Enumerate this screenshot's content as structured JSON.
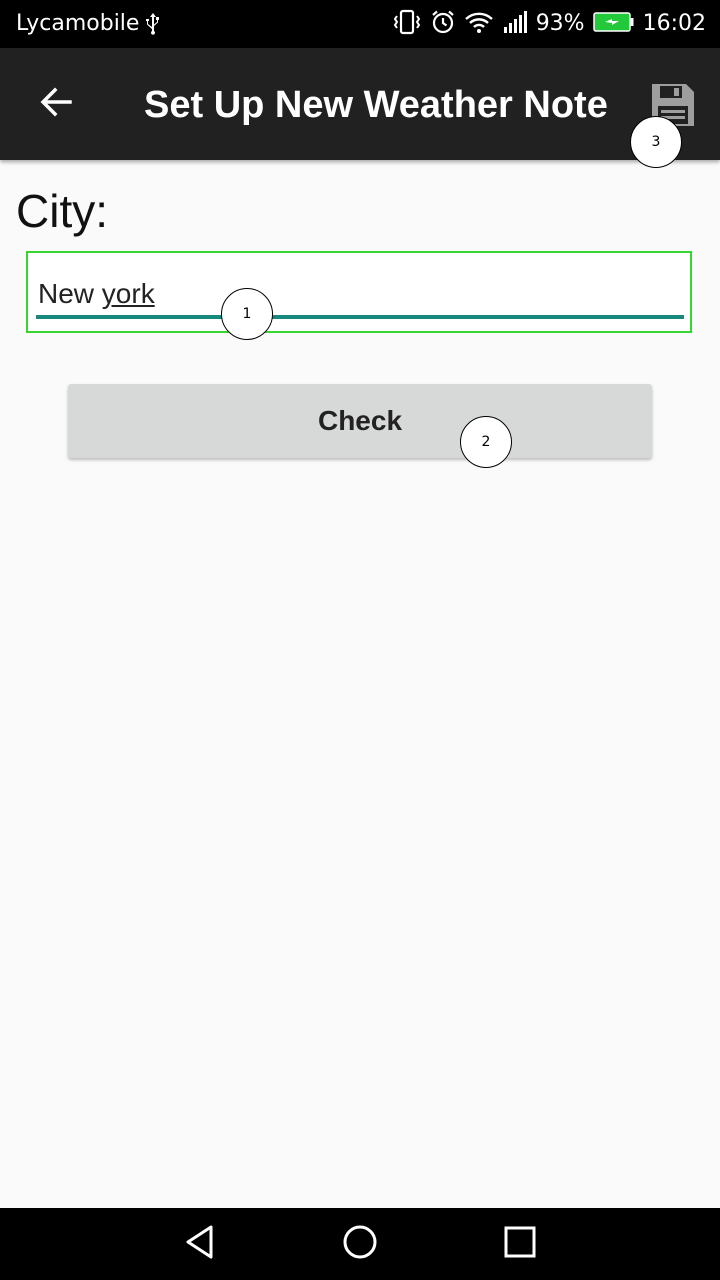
{
  "status_bar": {
    "carrier": "Lycamobile",
    "battery_percent": "93%",
    "time": "16:02",
    "icons": [
      "usb-icon",
      "vibrate-icon",
      "alarm-icon",
      "wifi-icon",
      "signal-icon",
      "battery-charging-icon"
    ]
  },
  "app_bar": {
    "title": "Set Up New Weather Note",
    "back_icon": "arrow-back-icon",
    "save_icon": "floppy-disk-icon"
  },
  "form": {
    "city_label": "City:",
    "city_value_word1": "New",
    "city_value_word2": "york",
    "city_value": "New york",
    "check_label": "Check"
  },
  "markers": {
    "m1": "1",
    "m2": "2",
    "m3": "3"
  },
  "colors": {
    "accent": "#14897c",
    "focus_box": "#37d62e",
    "app_bar": "#212121",
    "button": "#d7d8d8"
  },
  "nav_bar": {
    "icons": [
      "back-triangle-icon",
      "home-circle-icon",
      "recents-square-icon"
    ]
  }
}
